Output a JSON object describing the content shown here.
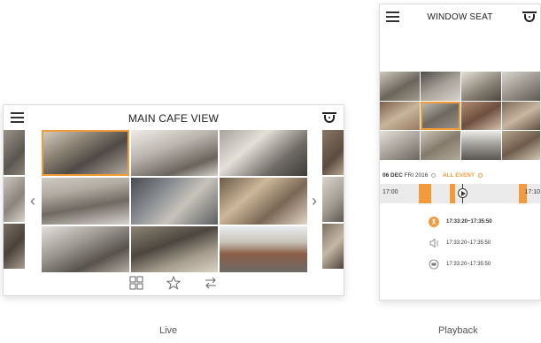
{
  "live": {
    "title": "MAIN CAFE VIEW",
    "caption": "Live",
    "toolbar": [
      "grid-layout-icon",
      "favorite-star-icon",
      "switch-arrows-icon"
    ]
  },
  "playback": {
    "title": "WINDOW SEAT",
    "caption": "Playback",
    "date": "06 DEC",
    "day_year": "FRI 2016",
    "event_filter": "ALL EVENT",
    "timeline_start": "17:00",
    "timeline_end": "17:10",
    "events": [
      {
        "icon": "motion-event-icon",
        "time": "17:33:20~17:35:50",
        "active": true
      },
      {
        "icon": "audio-event-icon",
        "time": "17:33:20~17:35:50",
        "active": false
      },
      {
        "icon": "recording-event-icon",
        "time": "17:33:20~17:35:50",
        "active": false
      }
    ]
  },
  "colors": {
    "accent": "#f39a3c",
    "timeline_bg": "#ebebeb",
    "text": "#333333"
  }
}
